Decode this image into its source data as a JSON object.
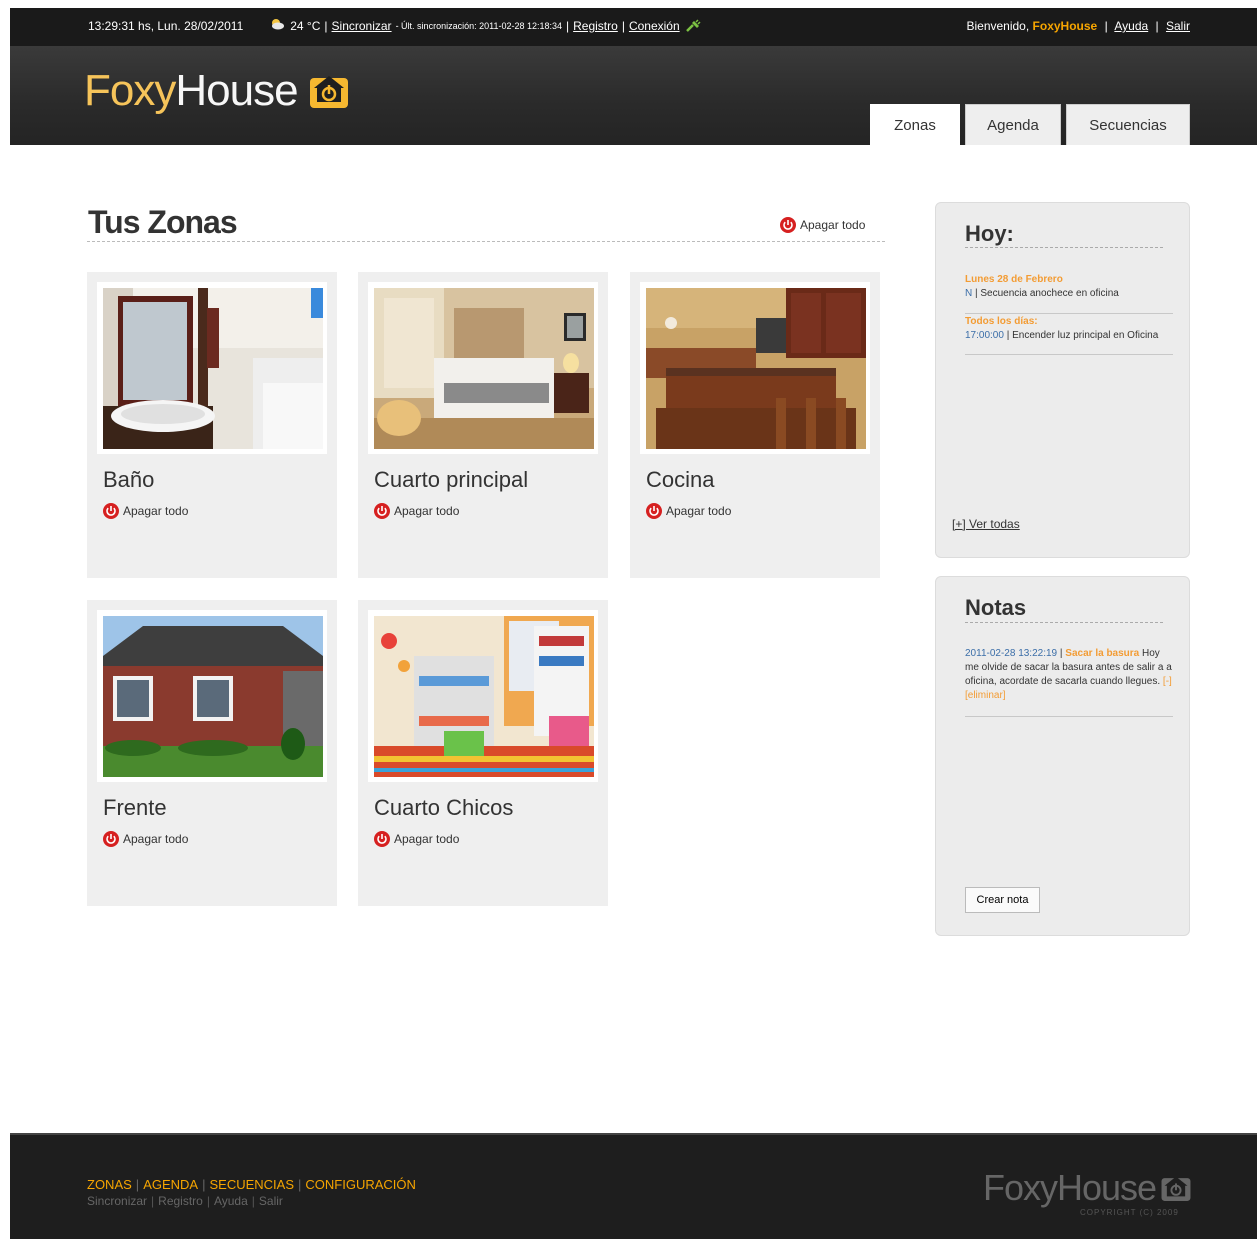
{
  "topbar": {
    "datetime": "13:29:31 hs, Lun. 28/02/2011",
    "temperature": "24 °C",
    "sync_link": "Sincronizar",
    "last_sync": "- Últ. sincronización: 2011-02-28 12:18:34",
    "register_link": "Registro",
    "connection_link": "Conexión",
    "welcome": "Bienvenido,",
    "username": "FoxyHouse",
    "help_link": "Ayuda",
    "logout_link": "Salir",
    "weather_icon": "sun-cloud-icon",
    "connection_icon": "plug-icon"
  },
  "header": {
    "logo_foxy": "Foxy",
    "logo_house": "House",
    "tabs": [
      "Zonas",
      "Agenda",
      "Secuencias"
    ],
    "active_tab": "Zonas"
  },
  "zones": {
    "title": "Tus Zonas",
    "turn_off_all": "Apagar todo",
    "items": [
      {
        "name": "Baño",
        "action": "Apagar todo"
      },
      {
        "name": "Cuarto principal",
        "action": "Apagar todo"
      },
      {
        "name": "Cocina",
        "action": "Apagar todo"
      },
      {
        "name": "Frente",
        "action": "Apagar todo"
      },
      {
        "name": "Cuarto Chicos",
        "action": "Apagar todo"
      }
    ]
  },
  "today": {
    "title": "Hoy:",
    "entries": [
      {
        "date": "Lunes 28 de Febrero",
        "prefix": "N",
        "text": "| Secuencia anochece en oficina"
      },
      {
        "date": "Todos los días:",
        "prefix": "17:00:00",
        "text": "| Encender luz principal en Oficina"
      }
    ],
    "see_all": "[+] Ver todas"
  },
  "notes": {
    "title": "Notas",
    "items": [
      {
        "timestamp": "2011-02-28 13:22:19",
        "separator": "|",
        "title": "Sacar la basura",
        "body": "Hoy me olvide de sacar la basura antes de salir a a oficina, acordate de sacarla cuando llegues.",
        "delete": "[-] [eliminar]"
      }
    ],
    "create_button": "Crear nota"
  },
  "footer": {
    "primary_nav": [
      "ZONAS",
      "AGENDA",
      "SECUENCIAS",
      "CONFIGURACIÓN"
    ],
    "secondary_nav": [
      "Sincronizar",
      "Registro",
      "Ayuda",
      "Salir"
    ],
    "logo": "FoxyHouse",
    "copyright": "COPYRIGHT (C) 2009"
  },
  "colors": {
    "accent": "#f6a500",
    "topbar_bg": "#1a1a1a",
    "header_bg": "#2e2e2e",
    "card_bg": "#efefef",
    "power_icon": "#d62020"
  }
}
